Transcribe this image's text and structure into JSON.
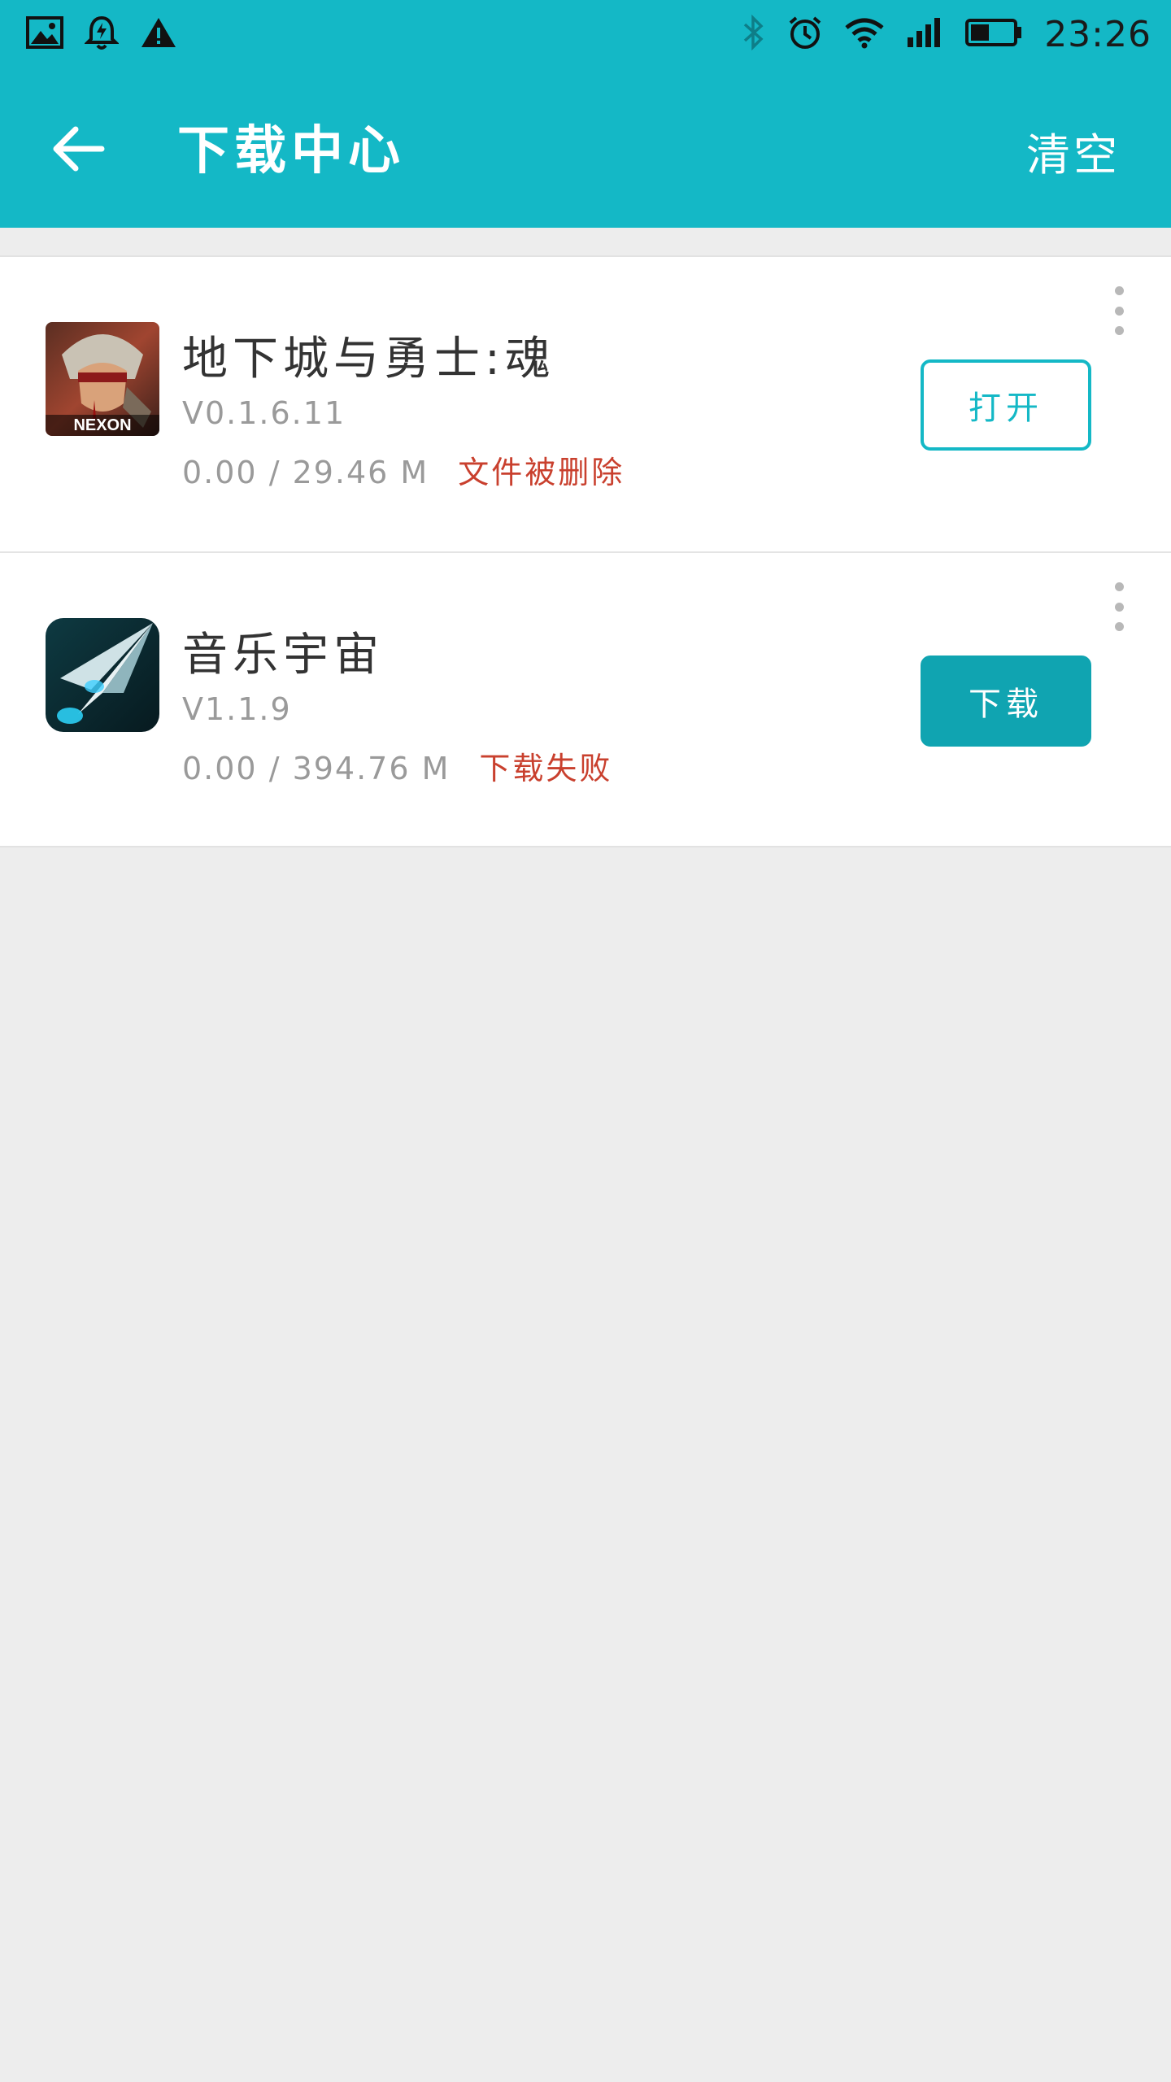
{
  "status_bar": {
    "time": "23:26",
    "left_icons": [
      "image-icon",
      "alarm-bell-icon",
      "warning-icon"
    ],
    "right_icons": [
      "bluetooth-icon",
      "alarm-clock-icon",
      "wifi-icon",
      "signal-icon",
      "battery-icon"
    ]
  },
  "app_bar": {
    "title": "下载中心",
    "clear_label": "清空",
    "back_icon": "back-arrow-icon",
    "color": "#14b8c6"
  },
  "downloads": [
    {
      "name": "地下城与勇士:魂",
      "version": "V0.1.6.11",
      "size": "0.00 / 29.46 M",
      "status": "文件被删除",
      "status_color": "#c9402e",
      "action_label": "打开",
      "action_style": "outline",
      "icon": "dungeon-fighter-app-icon",
      "icon_text": "NEXON"
    },
    {
      "name": "音乐宇宙",
      "version": "V1.1.9",
      "size": "0.00 / 394.76 M",
      "status": "下载失败",
      "status_color": "#c9402e",
      "action_label": "下载",
      "action_style": "filled",
      "icon": "music-universe-app-icon"
    }
  ]
}
